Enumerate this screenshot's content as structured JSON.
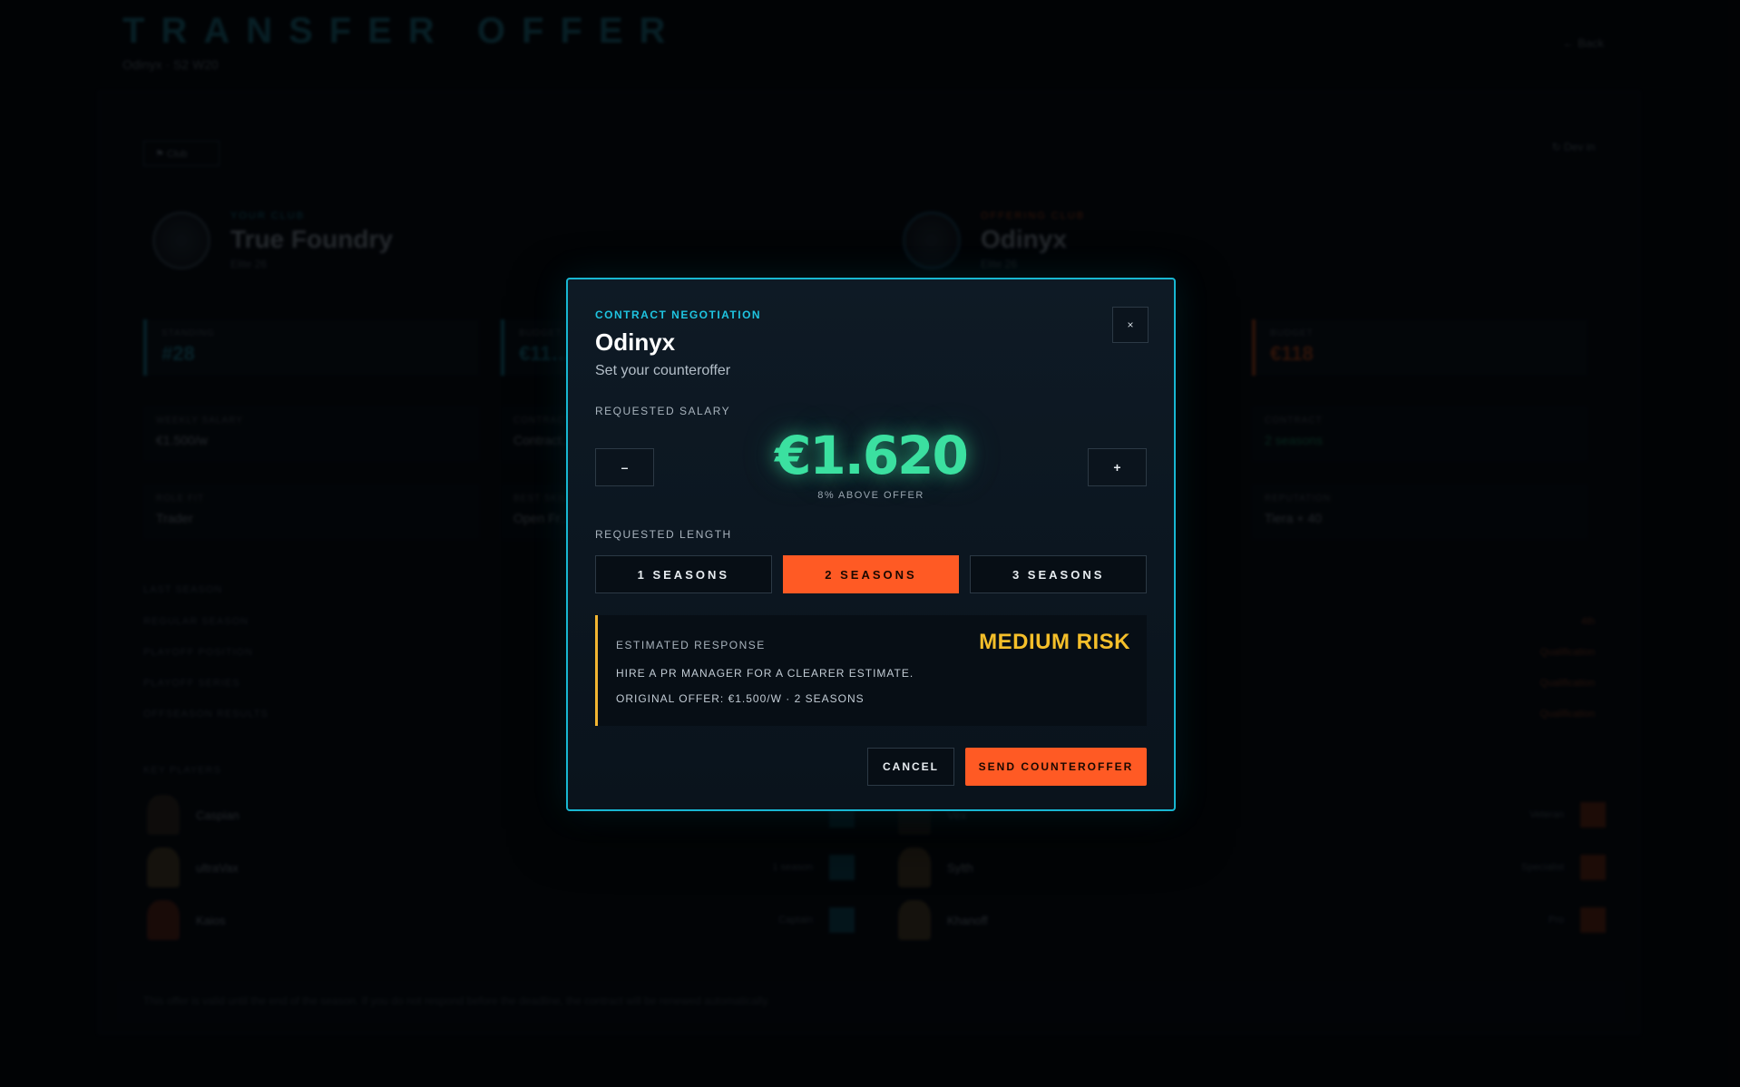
{
  "background": {
    "title": "TRANSFER OFFER",
    "subtitle": "Odinyx · S2 W20",
    "back_label": "← Back",
    "chip_label": "⚑ Club",
    "dev_label": "↻ Dev in",
    "clubs": [
      {
        "tag": "YOUR CLUB",
        "name": "True Foundry",
        "sub": "Elite 26"
      },
      {
        "tag": "OFFERING CLUB",
        "name": "Odinyx",
        "sub": "Elite 26"
      }
    ],
    "stats": [
      {
        "label": "STANDING",
        "value": "#28"
      },
      {
        "label": "BUDGET",
        "value": "€11…"
      },
      {
        "label": "BUDGET",
        "value": "€118"
      }
    ],
    "cells": [
      {
        "label": "WEEKLY SALARY",
        "value": "€1.500/w"
      },
      {
        "label": "CONTRACT",
        "value": "Contract…"
      },
      {
        "label": "CONTRACT",
        "value": "2 seasons"
      },
      {
        "label": "ROLE FIT",
        "value": "Trader"
      },
      {
        "label": "BEST SKILL",
        "value": "Open Fr…"
      },
      {
        "label": "REPUTATION",
        "value": "Tiera + 40"
      }
    ],
    "season_rows": [
      {
        "label": "LAST SEASON",
        "value": ""
      },
      {
        "label": "REGULAR SEASON",
        "value": "4th"
      },
      {
        "label": "PLAYOFF POSITION",
        "value": "Qualification"
      },
      {
        "label": "PLAYOFF SERIES",
        "value": "Qualification"
      },
      {
        "label": "OFFSEASON RESULTS",
        "value": "Qualification"
      }
    ],
    "players_label": "KEY PLAYERS",
    "players_left": [
      {
        "name": "Caspian",
        "value": ""
      },
      {
        "name": "ultraVax",
        "value": "1 season"
      },
      {
        "name": "Kaios",
        "value": "Captain"
      }
    ],
    "players_right": [
      {
        "name": "Vex",
        "value": "Veteran"
      },
      {
        "name": "Sylth",
        "value": "Specialist"
      },
      {
        "name": "Khanoff",
        "value": "Pro"
      }
    ],
    "footer_note": "This offer is valid until the end of the season. If you do not respond before the deadline, the contract will be renewed automatically."
  },
  "modal": {
    "tag": "CONTRACT NEGOTIATION",
    "title": "Odinyx",
    "subtitle": "Set your counteroffer",
    "close_label": "×",
    "salary_label": "REQUESTED SALARY",
    "decrement_label": "–",
    "increment_label": "+",
    "salary_value": "€1.620",
    "salary_note": "8% ABOVE OFFER",
    "length_label": "REQUESTED LENGTH",
    "lengths": [
      {
        "label": "1 SEASONS",
        "active": false
      },
      {
        "label": "2 SEASONS",
        "active": true
      },
      {
        "label": "3 SEASONS",
        "active": false
      }
    ],
    "estimate": {
      "label": "ESTIMATED RESPONSE",
      "risk": "MEDIUM RISK",
      "hint": "HIRE A PR MANAGER FOR A CLEARER ESTIMATE.",
      "original": "ORIGINAL OFFER: €1.500/W · 2 SEASONS"
    },
    "cancel_label": "CANCEL",
    "send_label": "SEND COUNTEROFFER"
  },
  "colors": {
    "accent_cyan": "#18b7d2",
    "accent_orange": "#ff5a24",
    "salary_green": "#3be0a0",
    "risk_yellow": "#f5bf2a"
  },
  "icons": [
    "close-icon",
    "club-crest-icon"
  ]
}
